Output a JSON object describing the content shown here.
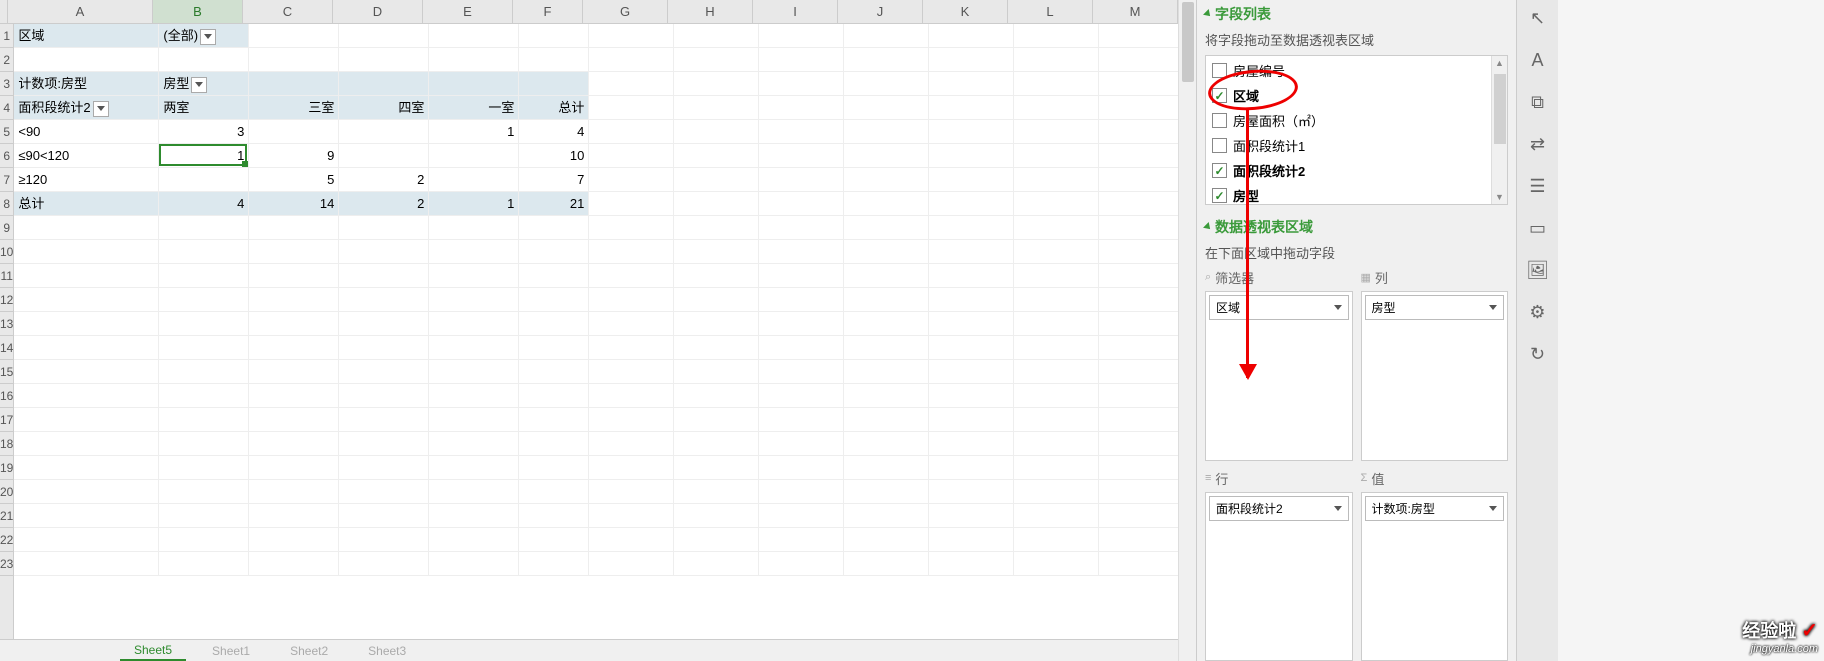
{
  "columns": [
    "A",
    "B",
    "C",
    "D",
    "E",
    "F",
    "G",
    "H",
    "I",
    "J",
    "K",
    "L",
    "M"
  ],
  "col_widths": [
    "wA",
    "wB",
    "wC",
    "wD",
    "wE",
    "wF",
    "wG",
    "wH",
    "wI",
    "wJ",
    "wK",
    "wL",
    "wM"
  ],
  "active_col_index": 1,
  "row_count": 23,
  "pivot": {
    "filter_label": "区域",
    "filter_value": "(全部)",
    "count_label": "计数项:房型",
    "col_field": "房型",
    "row_field": "面积段统计2",
    "col_headers": [
      "两室",
      "三室",
      "四室",
      "一室",
      "总计"
    ],
    "rows": [
      {
        "label": "<90",
        "vals": [
          "3",
          "",
          "",
          "1",
          "4"
        ]
      },
      {
        "label": "≤90<120",
        "vals": [
          "1",
          "9",
          "",
          "",
          "10"
        ]
      },
      {
        "label": "≥120",
        "vals": [
          "",
          "5",
          "2",
          "",
          "7"
        ]
      }
    ],
    "grand": {
      "label": "总计",
      "vals": [
        "4",
        "14",
        "2",
        "1",
        "21"
      ]
    }
  },
  "active_cell": {
    "row": 6,
    "col": "B",
    "value": "1"
  },
  "panel": {
    "title1": "字段列表",
    "subtitle1": "将字段拖动至数据透视表区域",
    "fields": [
      {
        "label": "房屋编号",
        "checked": false,
        "bold": false
      },
      {
        "label": "区域",
        "checked": true,
        "bold": true
      },
      {
        "label": "房屋面积（㎡）",
        "checked": false,
        "bold": false
      },
      {
        "label": "面积段统计1",
        "checked": false,
        "bold": false
      },
      {
        "label": "面积段统计2",
        "checked": true,
        "bold": true
      },
      {
        "label": "房型",
        "checked": true,
        "bold": true
      }
    ],
    "title2": "数据透视表区域",
    "subtitle2": "在下面区域中拖动字段",
    "areas": {
      "filter": {
        "label": "筛选器",
        "icon": "⌕",
        "items": [
          "区域"
        ]
      },
      "column": {
        "label": "列",
        "icon": "▦",
        "items": [
          "房型"
        ]
      },
      "row": {
        "label": "行",
        "icon": "≡",
        "items": [
          "面积段统计2"
        ]
      },
      "value": {
        "label": "值",
        "icon": "Σ",
        "items": [
          "计数项:房型"
        ]
      }
    }
  },
  "toolbar_icons": [
    "cursor",
    "font",
    "snap",
    "swap",
    "filter",
    "layout",
    "image",
    "gear",
    "refresh"
  ],
  "watermark": {
    "top": "经验啦",
    "check": "✓",
    "bottom": "jingyanla.com"
  },
  "sheet_tabs": [
    {
      "label": "Sheet5",
      "active": true
    },
    {
      "label": "Sheet1",
      "active": false
    },
    {
      "label": "Sheet2",
      "active": false
    },
    {
      "label": "Sheet3",
      "active": false
    }
  ]
}
